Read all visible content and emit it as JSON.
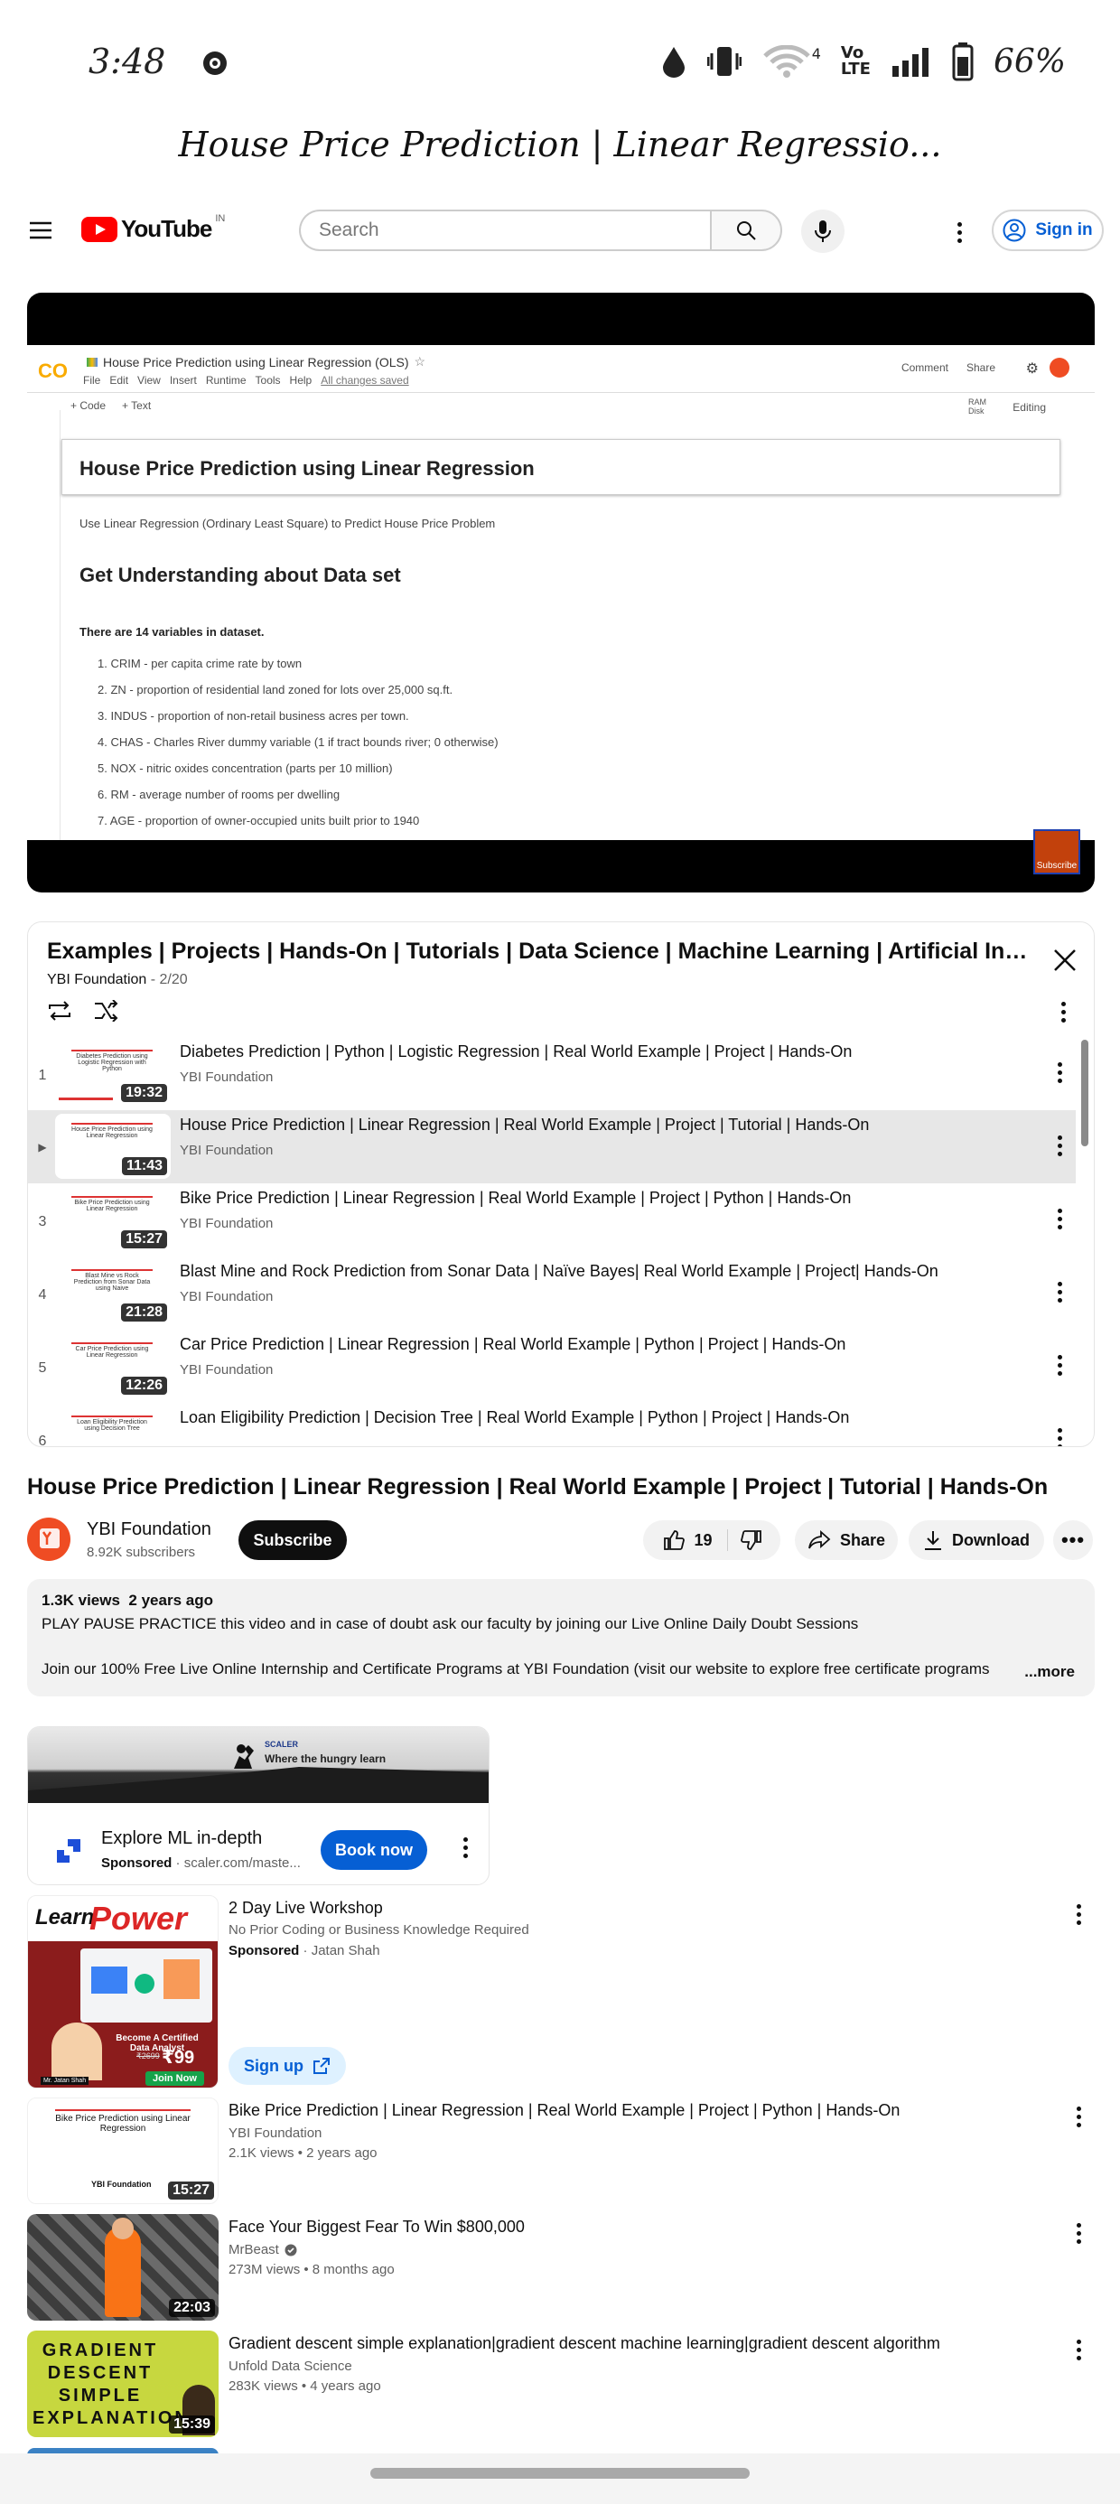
{
  "status_bar": {
    "time": "3:48",
    "battery": "66%",
    "network": "4"
  },
  "tab_title": "House Price Prediction | Linear Regressio...",
  "header": {
    "logo": "YouTube",
    "region": "IN",
    "search_placeholder": "Search",
    "sign_in": "Sign in"
  },
  "player": {
    "notebook_title": "House Price Prediction using Linear Regression (OLS)",
    "menu": [
      "File",
      "Edit",
      "View",
      "Insert",
      "Runtime",
      "Tools",
      "Help",
      "All changes saved"
    ],
    "toolbar": {
      "code": "+ Code",
      "text": "+ Text",
      "comment": "Comment",
      "share": "Share",
      "editing": "Editing",
      "ram": "RAM",
      "disk": "Disk"
    },
    "heading1": "House Price Prediction using Linear Regression",
    "intro": "Use Linear Regression (Ordinary Least Square) to Predict House Price Problem",
    "heading2": "Get Understanding about Data set",
    "vars_title": "There are 14 variables in dataset.",
    "vars": [
      "1. CRIM - per capita crime rate by town",
      "2. ZN - proportion of residential land zoned for lots over 25,000 sq.ft.",
      "3. INDUS - proportion of non-retail business acres per town.",
      "4. CHAS - Charles River dummy variable (1 if tract bounds river; 0 otherwise)",
      "5. NOX - nitric oxides concentration (parts per 10 million)",
      "6. RM - average number of rooms per dwelling",
      "7. AGE - proportion of owner-occupied units built prior to 1940"
    ],
    "subscribe_badge": "Subscribe"
  },
  "playlist": {
    "title": "Examples | Projects | Hands-On | Tutorials | Data Science | Machine Learning | Artificial Intellige...",
    "channel": "YBI Foundation",
    "position": "2/20",
    "items": [
      {
        "index": "1",
        "title": "Diabetes Prediction | Python | Logistic Regression | Real World Example | Project | Hands-On",
        "channel": "YBI Foundation",
        "duration": "19:32",
        "thumb": "Diabetes Prediction using Logistic Regression with Python"
      },
      {
        "index": "▶",
        "title": "House Price Prediction | Linear Regression | Real World Example | Project | Tutorial | Hands-On",
        "channel": "YBI Foundation",
        "duration": "11:43",
        "thumb": "House Price Prediction using Linear Regression"
      },
      {
        "index": "3",
        "title": "Bike Price Prediction | Linear Regression | Real World Example | Project | Python | Hands-On",
        "channel": "YBI Foundation",
        "duration": "15:27",
        "thumb": "Bike Price Prediction using Linear Regression"
      },
      {
        "index": "4",
        "title": "Blast Mine and Rock Prediction from Sonar Data | Naïve Bayes| Real World Example | Project| Hands-On",
        "channel": "YBI Foundation",
        "duration": "21:28",
        "thumb": "Blast Mine vs Rock Prediction from Sonar Data using Naive"
      },
      {
        "index": "5",
        "title": "Car Price Prediction | Linear Regression | Real World Example | Python | Project | Hands-On",
        "channel": "YBI Foundation",
        "duration": "12:26",
        "thumb": "Car Price Prediction using Linear Regression"
      },
      {
        "index": "6",
        "title": "Loan Eligibility Prediction | Decision Tree | Real World Example | Python | Project | Hands-On",
        "channel": "YBI Foundation",
        "duration": "",
        "thumb": "Loan Eligibility Prediction using Decision Tree"
      }
    ]
  },
  "video": {
    "title": "House Price Prediction | Linear Regression | Real World Example | Project | Tutorial | Hands-On",
    "channel": "YBI Foundation",
    "subscribers": "8.92K subscribers",
    "subscribe": "Subscribe",
    "likes": "19",
    "share": "Share",
    "download": "Download",
    "views": "1.3K views",
    "age": "2 years ago",
    "desc1": "PLAY PAUSE PRACTICE this video and in case of doubt ask our faculty by joining our Live Online Daily Doubt Sessions",
    "desc2": "Join our 100% Free Live Online Internship and Certificate Programs  at YBI Foundation (visit our website to explore free certificate programs",
    "more": "...more"
  },
  "ad": {
    "brand": "SCALER",
    "tagline": "Where the hungry learn",
    "title": "Explore ML in-depth",
    "sponsored": "Sponsored",
    "url": "scaler.com/maste...",
    "cta": "Book now"
  },
  "recs": [
    {
      "title": "2 Day Live Workshop",
      "line2": "No Prior Coding or Business Knowledge Required",
      "line3_a": "Sponsored",
      "line3_b": "Jatan Shah",
      "cta": "Sign up",
      "thumb_a": "Learn",
      "thumb_b": "Power BI",
      "thumb_c": "Become A Certified Data Analyst",
      "thumb_price": "₹99",
      "thumb_old": "₹2699",
      "thumb_join": "Join Now",
      "thumb_name": "Mr. Jatan Shah"
    },
    {
      "title": "Bike Price Prediction | Linear Regression | Real World Example | Project | Python | Hands-On",
      "channel": "YBI Foundation",
      "meta": "2.1K views • 2 years ago",
      "duration": "15:27",
      "thumb": "Bike Price Prediction using Linear Regression",
      "thumb_b": "YBI Foundation"
    },
    {
      "title": "Face Your Biggest Fear To Win $800,000",
      "channel": "MrBeast",
      "meta": "273M views • 8 months ago",
      "duration": "22:03"
    },
    {
      "title": "Gradient descent simple explanation|gradient descent machine learning|gradient descent algorithm",
      "channel": "Unfold Data Science",
      "meta": "283K views • 4 years ago",
      "duration": "15:39",
      "thumb": "GRADIENT DESCENT SIMPLE EXPLANATION"
    }
  ],
  "colors": {
    "brand_red": "#ff0000",
    "link_blue": "#065fd4",
    "ybi_orange": "#ef4c23"
  }
}
